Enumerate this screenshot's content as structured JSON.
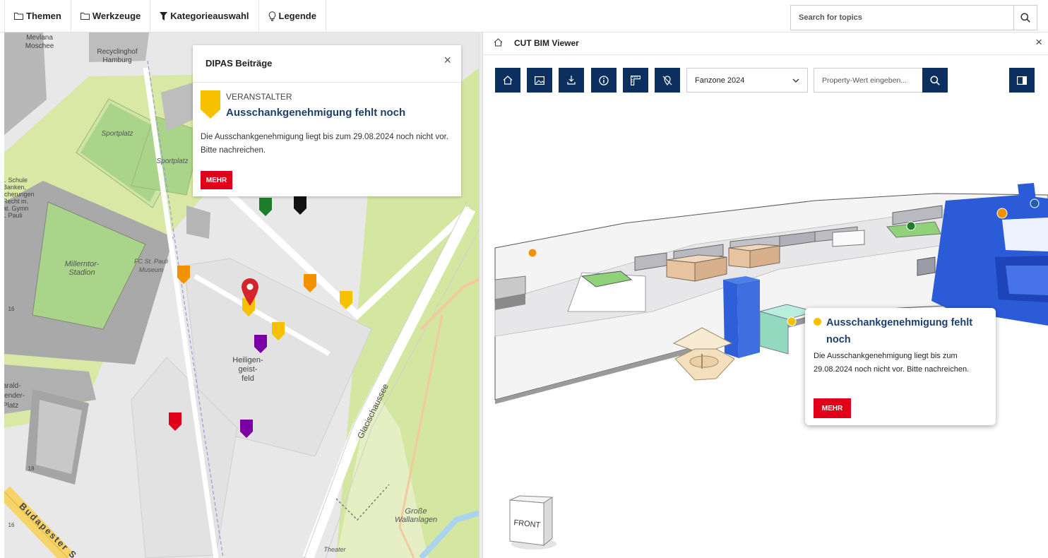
{
  "topbar": {
    "menu": [
      {
        "label": "Themen",
        "icon": "folder-icon"
      },
      {
        "label": "Werkzeuge",
        "icon": "folder-icon"
      },
      {
        "label": "Kategorieauswahl",
        "icon": "filter-icon"
      },
      {
        "label": "Legende",
        "icon": "lightbulb-icon"
      }
    ],
    "search_placeholder": "Search for topics"
  },
  "map": {
    "labels": {
      "moschee": "Mevlana\nMoschee",
      "recycling": "Recyclinghof\nHamburg",
      "sportplatz1": "Sportplatz",
      "sportplatz2": "Sportplatz",
      "stadion": "Millerntor-\nStadion",
      "museum": "FC St. Pauli\nMuseum",
      "heiligengeistfeld": "Heiligen-\ngeist-\nfeld",
      "glacischaussee": "Glacischaussee",
      "wallanlagen": "Große\nWallanlagen",
      "theater": "Theater",
      "budapester": "Budapester S",
      "schule": "t. Schule\nBanken,\nicherungen\nRecht m.\nat. Gymn\nt. Pauli",
      "platz": "arald-\nlender-\nPlatz",
      "hausnr_18": "18",
      "hausnr_16": "16",
      "hausnr_16b": "16"
    },
    "marker_colors": {
      "yellow": "#f7c100",
      "orange": "#f39200",
      "green": "#1e7d2b",
      "black": "#111111",
      "purple": "#7a00a3",
      "red": "#e10019",
      "pin": "#d3262c"
    }
  },
  "dipas": {
    "title": "DIPAS Beiträge",
    "close": "×",
    "category": "VERANSTALTER",
    "heading": "Ausschankgenehmigung fehlt noch",
    "text": "Die Ausschankgenehmigung liegt bis zum 29.08.2024 noch nicht vor. Bitte nachreichen.",
    "button": "MEHR"
  },
  "bim": {
    "title": "CUT BIM Viewer",
    "close": "×",
    "toolbar_icons": [
      "home-icon",
      "image-icon",
      "download-icon",
      "info-icon",
      "ruler-icon",
      "pin-off-icon",
      "panel-toggle-icon"
    ],
    "select_value": "Fanzone 2024",
    "property_placeholder": "Property-Wert eingeben...",
    "popup": {
      "heading": "Ausschankgenehmigung fehlt noch",
      "text": "Die Ausschankgenehmigung liegt bis zum 29.08.2024 noch nicht vor. Bitte nachreichen.",
      "button": "MEHR"
    },
    "navcube_label": "FRONT"
  }
}
